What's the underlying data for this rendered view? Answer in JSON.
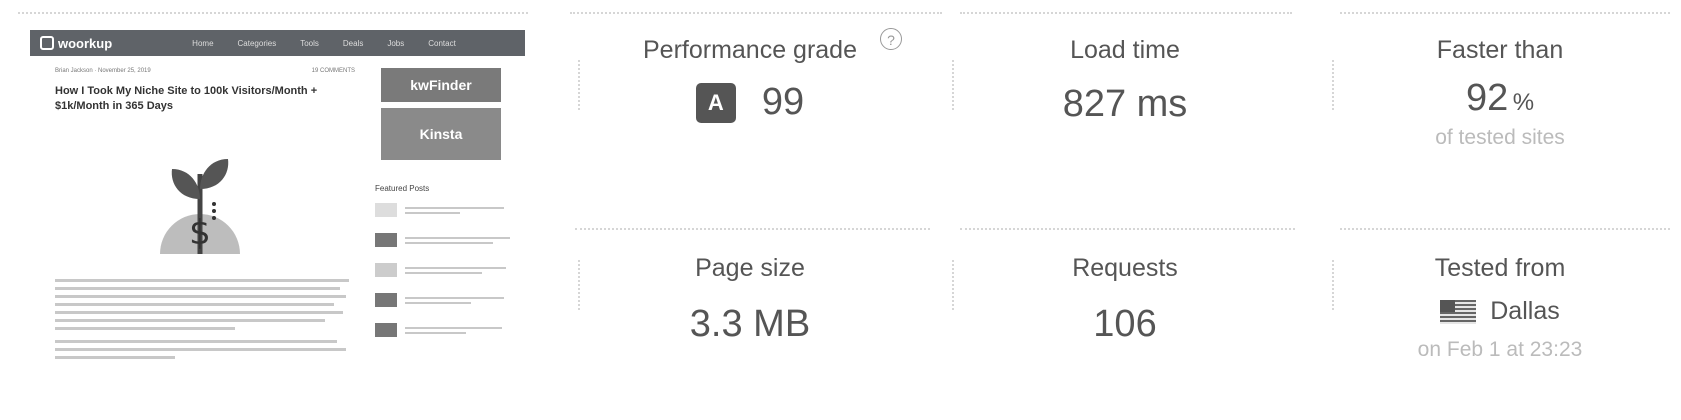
{
  "thumbnail": {
    "site_name": "woorkup",
    "nav_items": [
      "Home",
      "Categories",
      "Tools",
      "Deals",
      "Jobs",
      "Contact"
    ],
    "post_title": "How I Took My Niche Site to 100k Visitors/Month + $1k/Month in 365 Days",
    "author_line": "Brian Jackson · November 25, 2019",
    "comments": "19 COMMENTS",
    "ad1": "kwFinder",
    "ad2": "Kinsta",
    "featured_heading": "Featured Posts"
  },
  "metrics": {
    "performance_grade": {
      "label": "Performance grade",
      "letter": "A",
      "score": "99"
    },
    "load_time": {
      "label": "Load time",
      "value": "827 ms"
    },
    "faster_than": {
      "label": "Faster than",
      "value": "92",
      "unit": "%",
      "sub": "of tested sites"
    },
    "page_size": {
      "label": "Page size",
      "value": "3.3 MB"
    },
    "requests": {
      "label": "Requests",
      "value": "106"
    },
    "tested_from": {
      "label": "Tested from",
      "location": "Dallas",
      "date": "on Feb 1 at 23:23",
      "flag_icon": "us-flag-icon"
    }
  },
  "colors": {
    "badge_bg": "#555555",
    "text": "#555555",
    "muted": "#bbbbbb"
  }
}
